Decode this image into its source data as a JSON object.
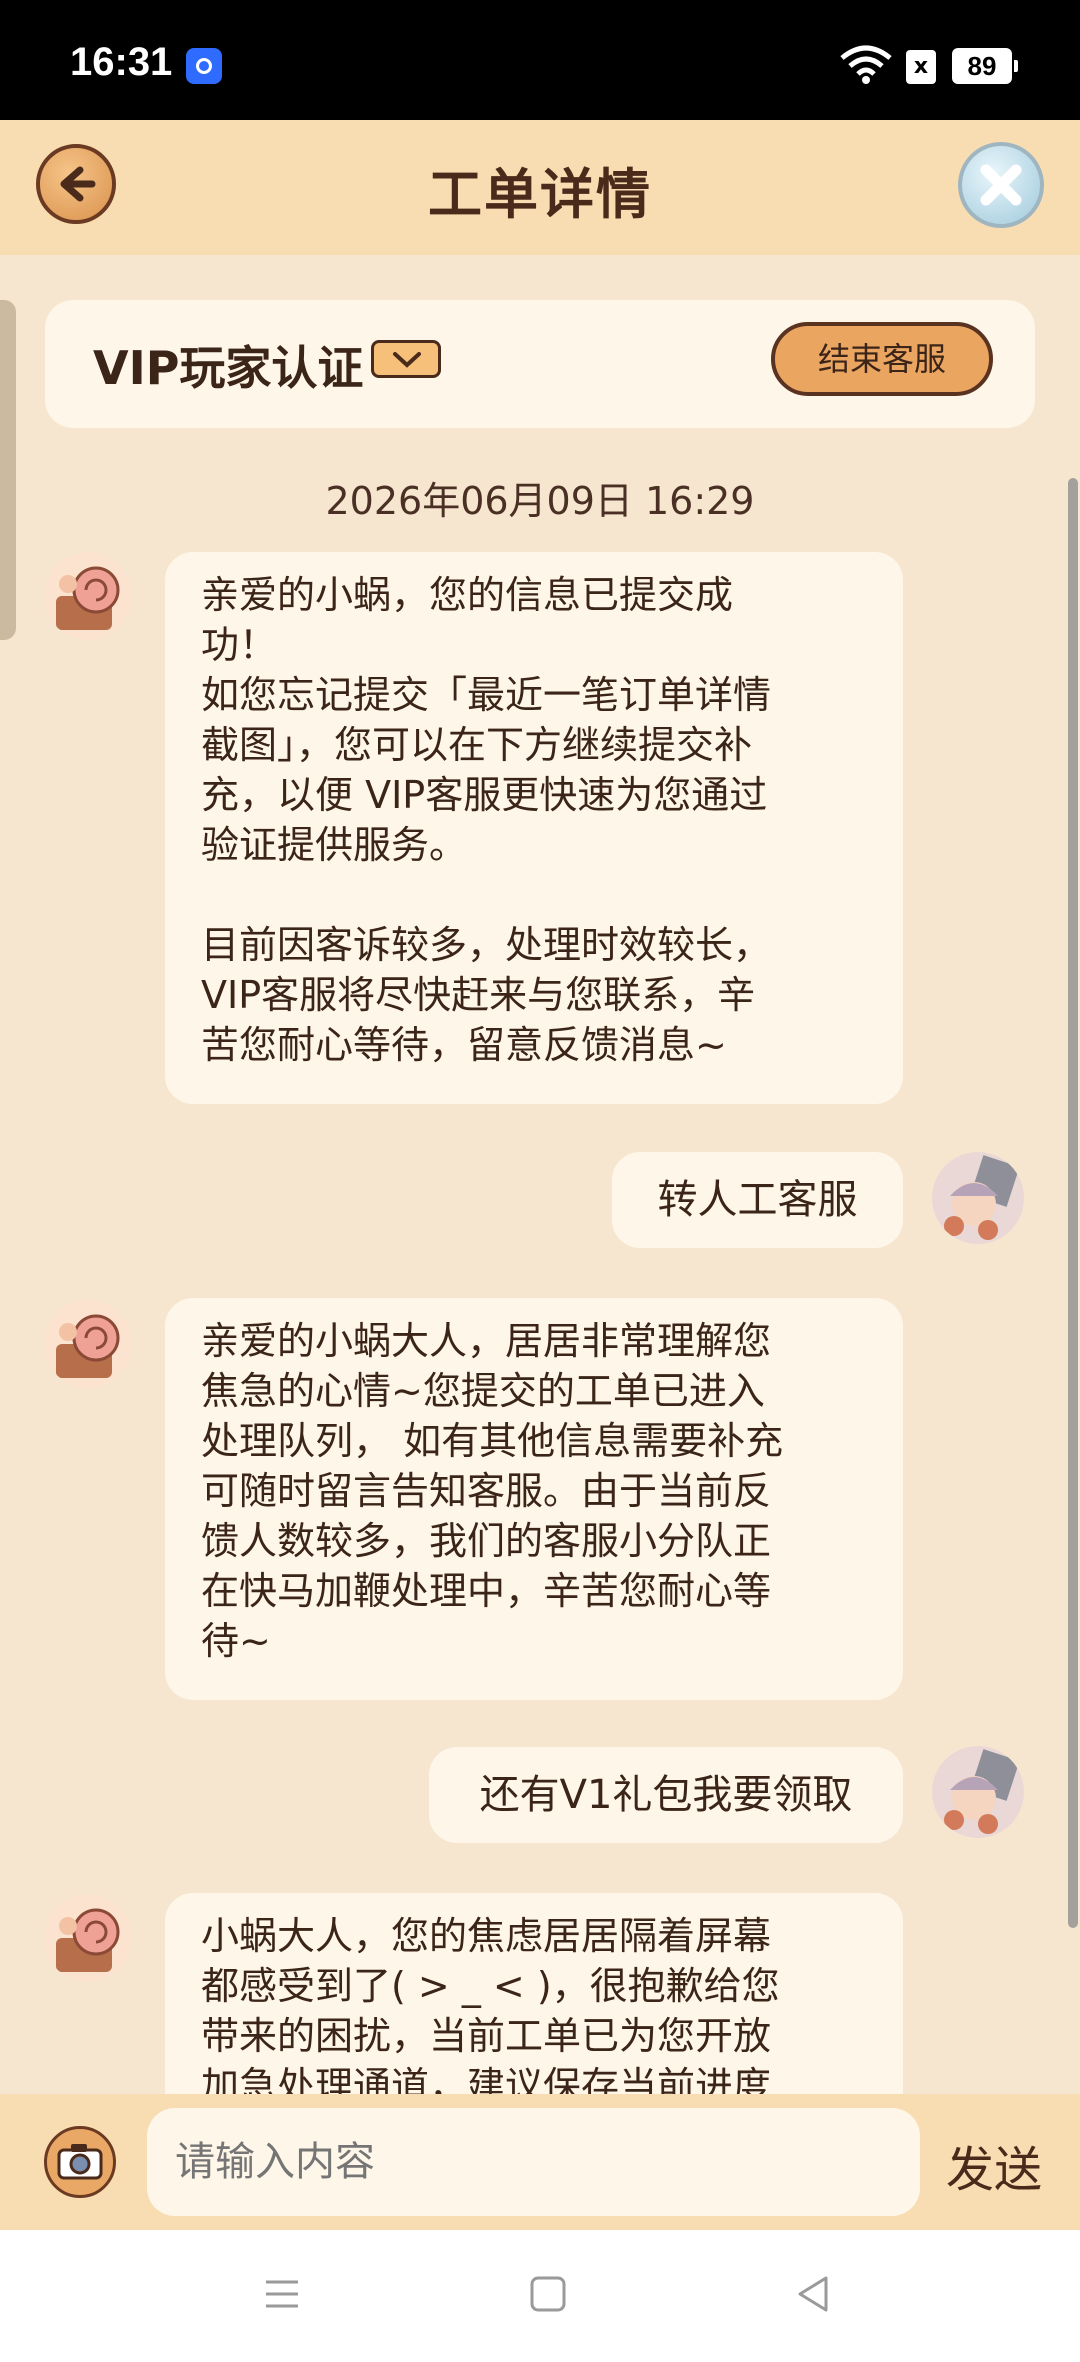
{
  "status_bar": {
    "time": "16:31",
    "battery": "89",
    "sim_icon": "x"
  },
  "header": {
    "title": "工单详情",
    "back_icon": "back-arrow-icon",
    "close_icon": "close-icon"
  },
  "vip_card": {
    "label": "VIP玩家认证",
    "end_button": "结束客服"
  },
  "timestamp": "2026年06月09日 16:29",
  "messages": [
    {
      "from": "service",
      "text": "亲爱的小蜗，您的信息已提交成\n功！\n如您忘记提交「最近一笔订单详情\n截图」，您可以在下方继续提交补\n充，以便 VIP客服更快速为您通过\n验证提供服务。\n\n目前因客诉较多，处理时效较长，\nVIP客服将尽快赶来与您联系，辛\n苦您耐心等待，留意反馈消息~"
    },
    {
      "from": "user",
      "text": "转人工客服"
    },
    {
      "from": "service",
      "text": "亲爱的小蜗大人，居居非常理解您\n焦急的心情~您提交的工单已进入\n处理队列， 如有其他信息需要补充\n可随时留言告知客服。由于当前反\n馈人数较多，我们的客服小分队正\n在快马加鞭处理中，辛苦您耐心等\n待~"
    },
    {
      "from": "user",
      "text": "还有V1礼包我要领取"
    },
    {
      "from": "service",
      "text": "小蜗大人，您的焦虑居居隔着屏幕\n都感受到了( > _ < )，很抱歉给您\n带来的困扰，当前工单已为您开放\n加急处理通道，建议保存当前进度"
    }
  ],
  "input": {
    "placeholder": "请输入内容",
    "send_label": "发送",
    "camera_icon": "camera-icon"
  },
  "nav": {
    "menu_icon": "menu-icon",
    "home_icon": "home-icon",
    "back_icon": "back-triangle-icon"
  }
}
